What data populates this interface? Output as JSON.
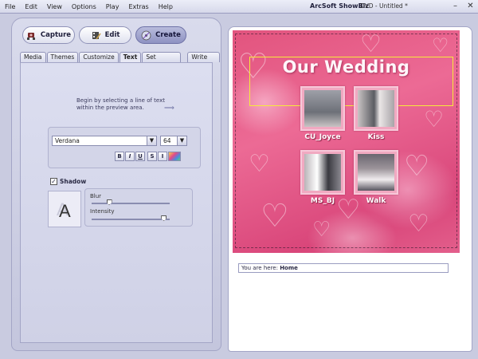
{
  "menubar": {
    "items": [
      "File",
      "Edit",
      "View",
      "Options",
      "Play",
      "Extras",
      "Help"
    ],
    "app_title": "ArcSoft ShowBiz",
    "document_title": "DVD - Untitled *"
  },
  "mode_buttons": {
    "capture": "Capture",
    "edit": "Edit",
    "create": "Create",
    "active": "create"
  },
  "tabs": {
    "items": [
      "Media",
      "Themes",
      "Customize",
      "Text",
      "Set Chapters",
      "Write Disc"
    ],
    "active": "Text"
  },
  "text_panel": {
    "instruction_line1": "Begin by selecting a line of text",
    "instruction_line2": "within the preview area.",
    "font_family": "Verdana",
    "font_size": "64",
    "style_buttons": [
      "B",
      "I",
      "U",
      "S",
      "I"
    ],
    "shadow_label": "Shadow",
    "shadow_checked": true,
    "shadow_preview_text": "A",
    "blur_label": "Blur",
    "blur_value": 0.22,
    "intensity_label": "Intensity",
    "intensity_value": 0.92
  },
  "preview": {
    "menu_title": "Our Wedding",
    "thumbnails": [
      {
        "label": "CU_Joyce"
      },
      {
        "label": "Kiss"
      },
      {
        "label": "MS_BJ"
      },
      {
        "label": "Walk"
      }
    ],
    "location_prefix": "You are here: ",
    "location_value": "Home"
  },
  "colors": {
    "accent": "#8e92c2",
    "background_pink": "#e2547e",
    "selection_yellow": "#f6ea3a"
  }
}
